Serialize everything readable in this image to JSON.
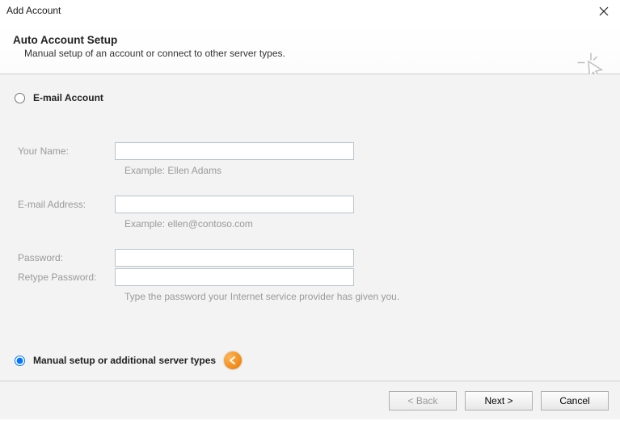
{
  "window": {
    "title": "Add Account"
  },
  "header": {
    "title": "Auto Account Setup",
    "subtitle": "Manual setup of an account or connect to other server types."
  },
  "options": {
    "email_account_label": "E-mail Account",
    "manual_setup_label": "Manual setup or additional server types",
    "selected": "manual"
  },
  "fields": {
    "your_name": {
      "label": "Your Name:",
      "value": "",
      "example": "Example: Ellen Adams"
    },
    "email": {
      "label": "E-mail Address:",
      "value": "",
      "example": "Example: ellen@contoso.com"
    },
    "password": {
      "label": "Password:",
      "value": ""
    },
    "retype_password": {
      "label": "Retype Password:",
      "value": "",
      "hint": "Type the password your Internet service provider has given you."
    }
  },
  "footer": {
    "back_label": "< Back",
    "next_label": "Next >",
    "cancel_label": "Cancel"
  }
}
